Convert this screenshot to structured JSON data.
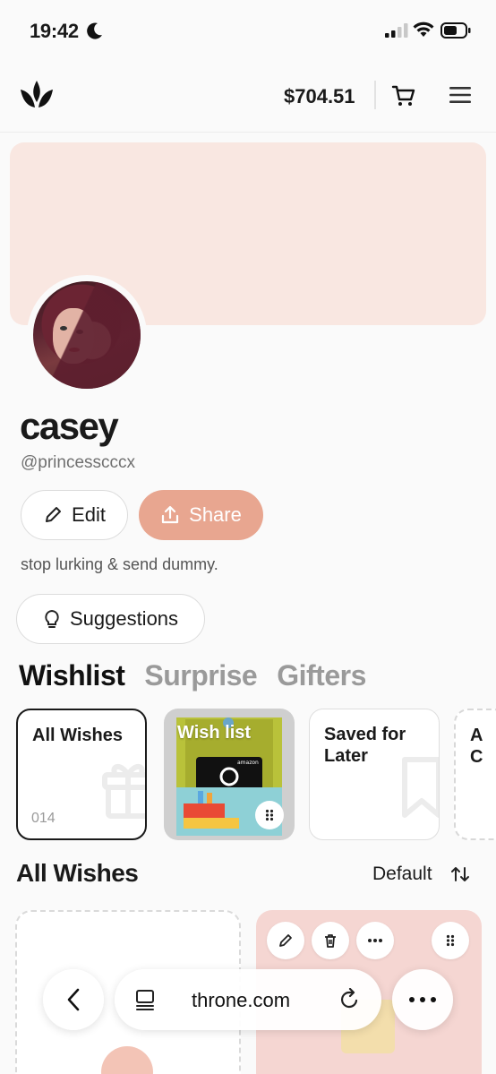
{
  "status_bar": {
    "time": "19:42"
  },
  "header": {
    "balance": "$704.51"
  },
  "profile": {
    "name": "casey",
    "handle": "@princesscccx",
    "bio": "stop lurking & send dummy."
  },
  "actions": {
    "edit_label": "Edit",
    "share_label": "Share",
    "suggestions_label": "Suggestions"
  },
  "tabs": [
    {
      "label": "Wishlist",
      "active": true
    },
    {
      "label": "Surprise",
      "active": false
    },
    {
      "label": "Gifters",
      "active": false
    }
  ],
  "collections": [
    {
      "title": "All Wishes",
      "count": "014"
    },
    {
      "title": "Wish list"
    },
    {
      "title": "Saved for Later"
    },
    {
      "title": "A C"
    }
  ],
  "section": {
    "title": "All Wishes",
    "sort_label": "Default"
  },
  "browser": {
    "url": "throne.com"
  },
  "colors": {
    "accent": "#e8a690",
    "banner": "#f9e7e1",
    "text": "#1a1a1a"
  }
}
